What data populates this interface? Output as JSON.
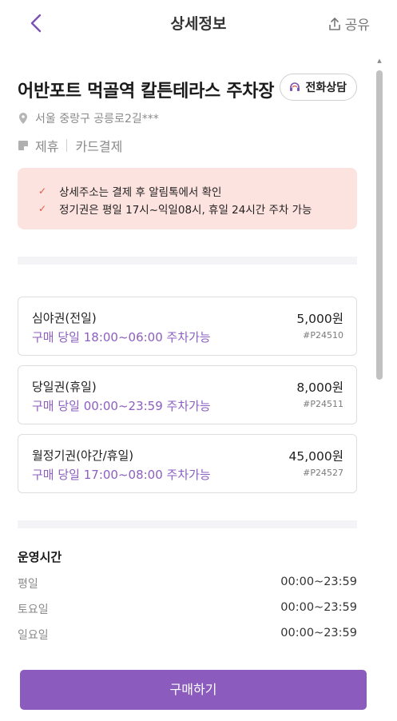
{
  "header": {
    "title": "상세정보",
    "share_label": "공유",
    "icons": {
      "back": "chevron-left-icon",
      "share": "share-icon"
    }
  },
  "lot": {
    "name": "어반포트 먹골역 칼튼테라스 주차장",
    "call_label": "전화상담",
    "address": "서울 중랑구 공릉로2길***",
    "features": [
      "제휴",
      "카드결제"
    ]
  },
  "notices": [
    "상세주소는 결제 후 알림톡에서 확인",
    "정기권은 평일 17시~익일08시, 휴일 24시간 주차 가능"
  ],
  "tickets": [
    {
      "name": "심야권(전일)",
      "desc": "구매 당일 18:00~06:00 주차가능",
      "price": "5,000원",
      "code": "#P24510"
    },
    {
      "name": "당일권(휴일)",
      "desc": "구매 당일 00:00~23:59 주차가능",
      "price": "8,000원",
      "code": "#P24511"
    },
    {
      "name": "월정기권(야간/휴일)",
      "desc": "구매 당일 17:00~08:00 주차가능",
      "price": "45,000원",
      "code": "#P24527"
    }
  ],
  "hours": {
    "title": "운영시간",
    "rows": [
      {
        "day": "평일",
        "time": "00:00~23:59"
      },
      {
        "day": "토요일",
        "time": "00:00~23:59"
      },
      {
        "day": "일요일",
        "time": "00:00~23:59"
      }
    ]
  },
  "buy_label": "구매하기",
  "colors": {
    "accent": "#8b5cbd",
    "notice_bg": "#fde3df",
    "check": "#e05a45"
  }
}
